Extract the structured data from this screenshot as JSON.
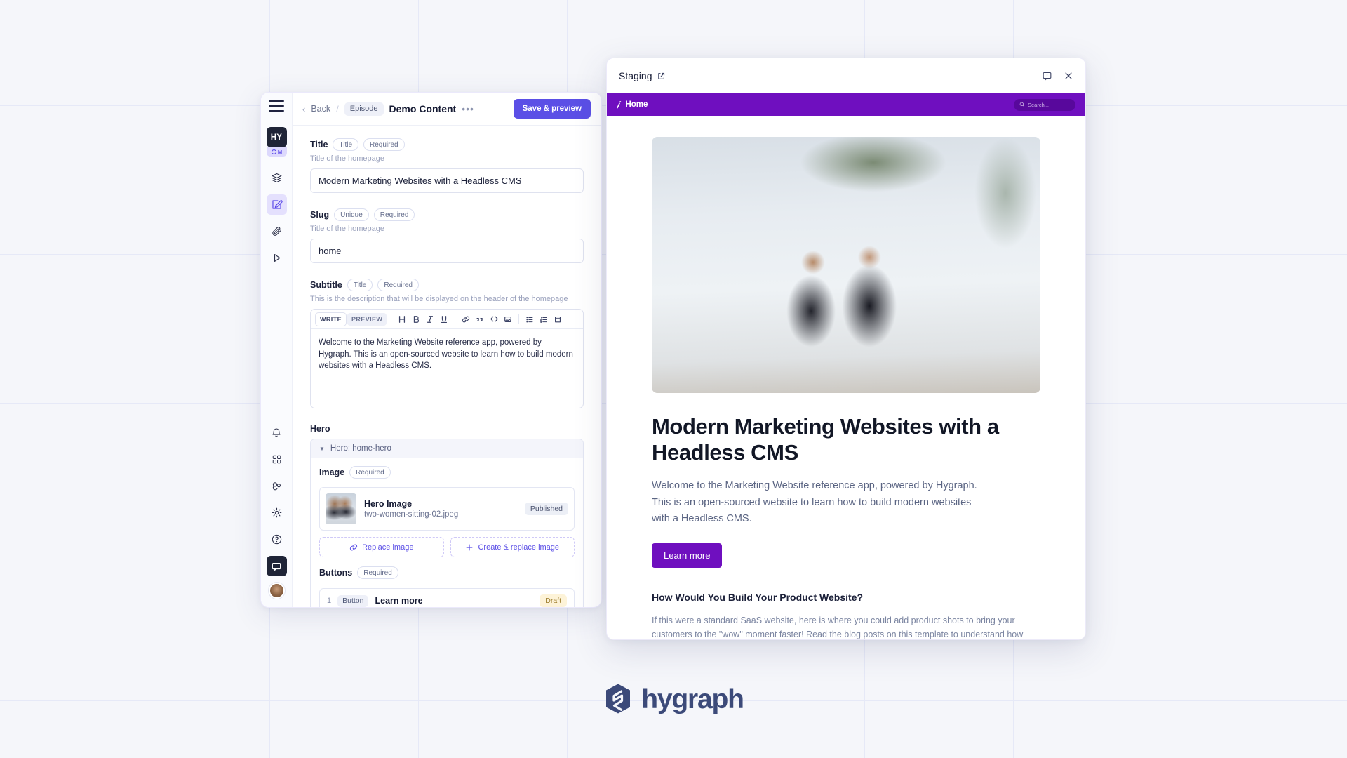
{
  "background": {
    "color": "#f5f6fa",
    "grid_color": "#e6e9f7"
  },
  "brand": {
    "name": "hygraph",
    "mark": "hygraph-logo-icon"
  },
  "editor": {
    "sidebar": {
      "menu_icon": "hamburger-menu-icon",
      "project_initials": "HY",
      "project_env": "M",
      "items": [
        {
          "name": "schema-icon",
          "label": "Schema"
        },
        {
          "name": "content-edit-icon",
          "label": "Content",
          "active": true
        },
        {
          "name": "assets-icon",
          "label": "Assets"
        },
        {
          "name": "play-icon",
          "label": "API Playground"
        }
      ],
      "bottom_items": [
        {
          "name": "bell-icon",
          "label": "Notifications"
        },
        {
          "name": "apps-grid-icon",
          "label": "Apps"
        },
        {
          "name": "webhooks-icon",
          "label": "Webhooks"
        },
        {
          "name": "gear-icon",
          "label": "Settings"
        },
        {
          "name": "help-circle-icon",
          "label": "Help"
        },
        {
          "name": "chat-icon",
          "label": "Feedback",
          "active": true
        }
      ],
      "avatar": "user-avatar"
    },
    "topbar": {
      "back_label": "Back",
      "separator": "/",
      "model_chip": "Episode",
      "title": "Demo Content",
      "more_label": "•••",
      "save_label": "Save & preview"
    },
    "fields": [
      {
        "label": "Title",
        "pills": [
          "Title",
          "Required"
        ],
        "help": "Title of the homepage",
        "value": "Modern Marketing Websites with a Headless CMS"
      },
      {
        "label": "Slug",
        "pills": [
          "Unique",
          "Required"
        ],
        "help": "Title of the homepage",
        "value": "home"
      }
    ],
    "subtitle_field": {
      "label": "Subtitle",
      "pills": [
        "Title",
        "Required"
      ],
      "help": "This is the description that will be displayed on the header of the homepage",
      "tabs": {
        "write": "WRITE",
        "preview": "PREVIEW"
      },
      "tools": [
        "heading-icon",
        "bold-icon",
        "italic-icon",
        "underline-icon",
        "link-icon",
        "quote-icon",
        "code-icon",
        "image-icon",
        "bullet-list-icon",
        "numbered-list-icon",
        "table-icon"
      ],
      "value": "Welcome to the Marketing Website reference app, powered by Hygraph. This is an open-sourced website to learn how to build modern websites with a Headless CMS."
    },
    "hero": {
      "section_label": "Hero",
      "component_title": "Hero: home-hero",
      "image_field": {
        "label": "Image",
        "pill": "Required",
        "asset_name": "Hero Image",
        "asset_file": "two-women-sitting-02.jpeg",
        "status": "Published",
        "replace_label": "Replace image",
        "create_label": "Create & replace image"
      },
      "buttons_field": {
        "label": "Buttons",
        "pill": "Required",
        "rows": [
          {
            "index": "1",
            "type": "Button",
            "name": "Learn more",
            "status": "Draft"
          }
        ]
      }
    }
  },
  "preview": {
    "title": "Staging",
    "external_icon": "external-link-icon",
    "comment_icon": "comment-icon",
    "close_icon": "close-icon",
    "site_nav": {
      "logo": "hygraph-mark-icon",
      "home_label": "Home",
      "search_placeholder": "Search...",
      "bar_color": "#6f0fbf"
    },
    "hero_image_alt": "two women sitting against a white wall",
    "heading": "Modern Marketing Websites with a Headless CMS",
    "paragraph": "Welcome to the Marketing Website reference app, powered by Hygraph. This is an open-sourced website to learn how to build modern websites with a Headless CMS.",
    "cta_label": "Learn more",
    "section_heading": "How Would You Build Your Product Website?",
    "section_body": "If this were a standard SaaS website, here is where you could add product shots to bring your customers to the \"wow\" moment faster! Read the blog posts on this template to understand how everything works."
  }
}
